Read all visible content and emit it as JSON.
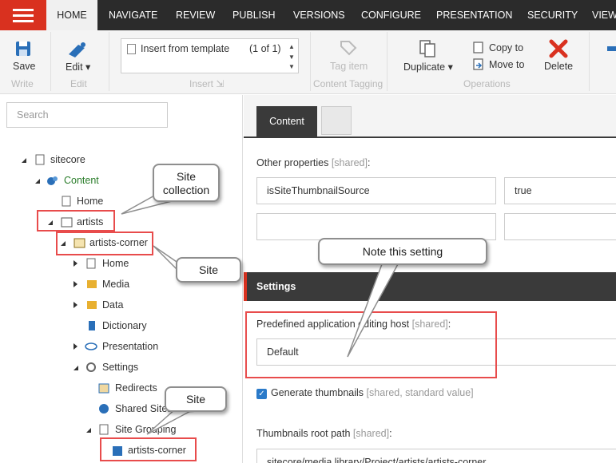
{
  "nav": {
    "tabs": [
      "HOME",
      "NAVIGATE",
      "REVIEW",
      "PUBLISH",
      "VERSIONS",
      "CONFIGURE",
      "PRESENTATION",
      "SECURITY",
      "VIEW"
    ]
  },
  "ribbon": {
    "save": "Save",
    "edit": "Edit",
    "write_group": "Write",
    "edit_group": "Edit",
    "template_label": "Insert from template",
    "template_count": "(1 of 1)",
    "insert_group": "Insert",
    "tag_item": "Tag item",
    "content_tagging_group": "Content Tagging",
    "duplicate": "Duplicate",
    "copy_to": "Copy to",
    "move_to": "Move to",
    "delete": "Delete",
    "operations_group": "Operations"
  },
  "search": {
    "placeholder": "Search"
  },
  "tree": {
    "sitecore": "sitecore",
    "content": "Content",
    "home": "Home",
    "artists": "artists",
    "artists_corner": "artists-corner",
    "home2": "Home",
    "media": "Media",
    "data": "Data",
    "dictionary": "Dictionary",
    "presentation": "Presentation",
    "settings": "Settings",
    "redirects": "Redirects",
    "shared_sites": "Shared Sites",
    "site_grouping": "Site Grouping",
    "artists_corner_leaf": "artists-corner"
  },
  "editor": {
    "content_tab": "Content",
    "other_properties": "Other properties",
    "shared": "[shared]",
    "key1": "isSiteThumbnailSource",
    "val1": "true",
    "settings_section": "Settings",
    "predefined_label": "Predefined application editing host",
    "predefined_value": "Default",
    "generate_thumbnails": "Generate thumbnails",
    "shared_standard": "[shared, standard value]",
    "thumbnails_root": "Thumbnails root path",
    "thumbnails_value": "sitecore/media library/Project/artists/artists-corner"
  },
  "callouts": {
    "site_collection": "Site collection",
    "site1": "Site",
    "note": "Note this setting",
    "site2": "Site"
  },
  "colors": {
    "accent": "#d9311f",
    "highlight": "#e84c4c",
    "nav_bg": "#2b2b2b"
  }
}
